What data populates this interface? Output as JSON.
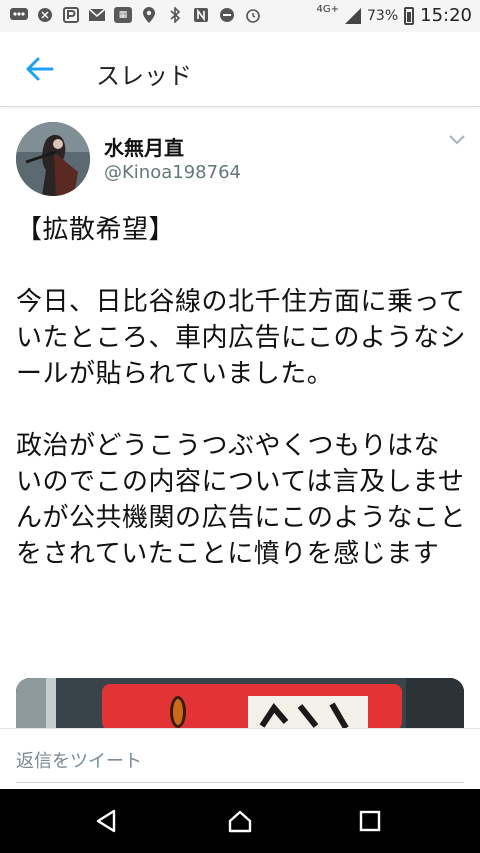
{
  "status_bar": {
    "network": "4G+",
    "battery": "73%",
    "time": "15:20",
    "left_icons": [
      "messages-icon",
      "phone-icon",
      "p-icon",
      "mail-icon",
      "app-icon",
      "location-icon",
      "bluetooth-icon",
      "nfc-icon",
      "dnd-icon",
      "alarm-icon"
    ]
  },
  "app_bar": {
    "title": "スレッド",
    "back_label": "←"
  },
  "tweet": {
    "name": "水無月直",
    "handle": "@Kinoa198764",
    "paragraphs": [
      "【拡散希望】",
      "今日、日比谷線の北千住方面に乗っていたところ、車内広告にこのようなシールが貼られていました。",
      "政治がどうこうつぶやくつもりはないのでこの内容については言及しませんが公共機関の広告にこのようなことをされていたことに憤りを感じます"
    ]
  },
  "reply": {
    "placeholder": "返信をツイート"
  },
  "colors": {
    "accent": "#1da1f2",
    "handle": "#667788"
  }
}
